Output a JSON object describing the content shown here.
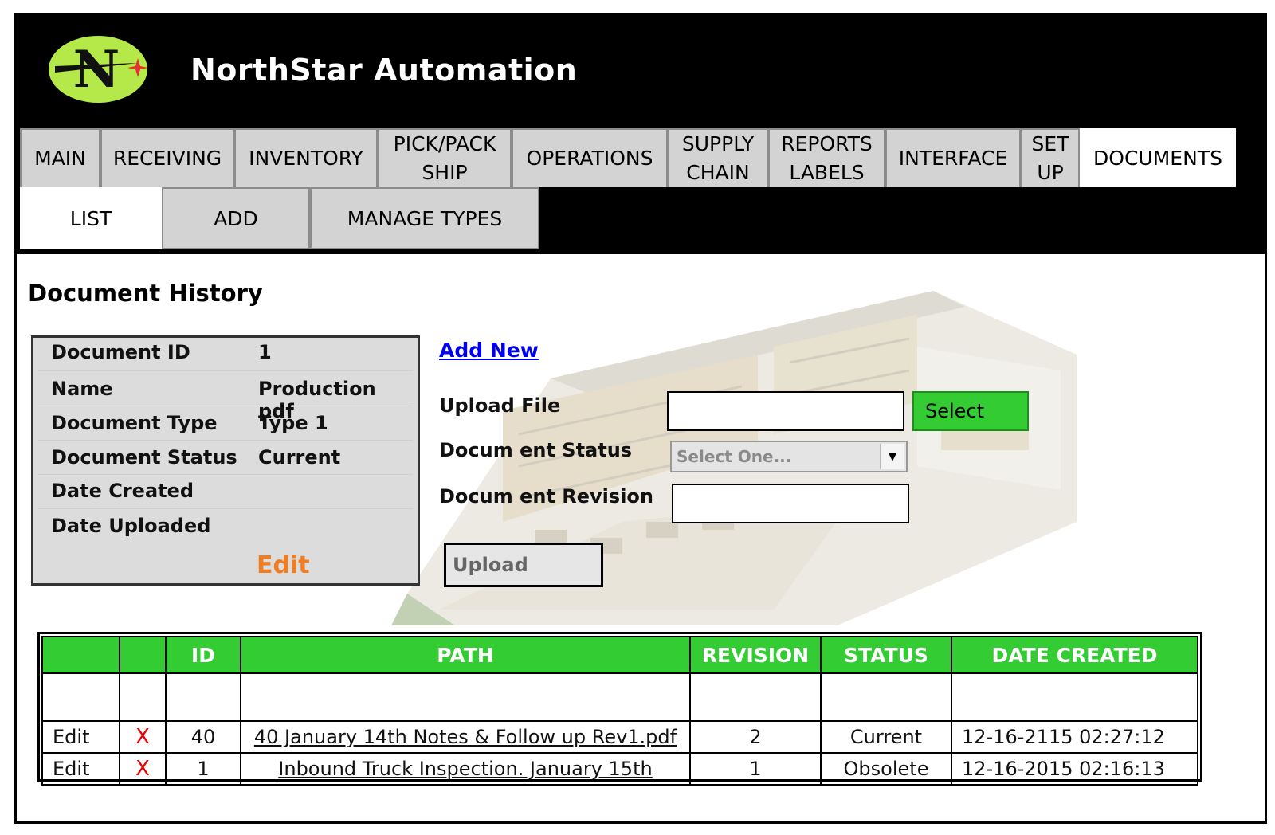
{
  "app": {
    "title": "NorthStar Automation",
    "logo_letter": "N"
  },
  "nav": {
    "tabs": [
      {
        "label": "MAIN"
      },
      {
        "label": "RECEIVING"
      },
      {
        "label": "INVENTORY"
      },
      {
        "label": "PICK/PACK\nSHIP"
      },
      {
        "label": "OPERATIONS"
      },
      {
        "label": "SUPPLY\nCHAIN"
      },
      {
        "label": "REPORTS\nLABELS"
      },
      {
        "label": "INTERFACE"
      },
      {
        "label": "SET\nUP"
      },
      {
        "label": "DOCUMENTS",
        "active": true
      }
    ]
  },
  "subnav": {
    "tabs": [
      {
        "label": "LIST",
        "active": true
      },
      {
        "label": "ADD"
      },
      {
        "label": "MANAGE TYPES"
      }
    ]
  },
  "page": {
    "title": "Document History"
  },
  "details": {
    "rows": [
      {
        "label": "Document ID",
        "value": "1"
      },
      {
        "label": "Name",
        "value": "Production pdf"
      },
      {
        "label": "Document Type",
        "value": "Type 1"
      },
      {
        "label": "Document Status",
        "value": "Current"
      },
      {
        "label": "Date Created",
        "value": ""
      },
      {
        "label": "Date Uploaded",
        "value": ""
      }
    ],
    "edit_label": "Edit"
  },
  "upload_form": {
    "add_new_label": "Add New",
    "upload_file_label": "Upload File",
    "upload_file_value": "",
    "select_label": "Select",
    "status_label": "Docum ent Status",
    "status_selected": "Select One...",
    "revision_label": "Docum ent Revision",
    "revision_value": "",
    "upload_label": "Upload"
  },
  "table": {
    "columns": [
      "",
      "",
      "ID",
      "PATH",
      "REVISION",
      "STATUS",
      "DATE CREATED"
    ],
    "rows": [
      {
        "edit": "Edit",
        "delete": "X",
        "id": "40",
        "path": "40 January 14th Notes & Follow up Rev1.pdf",
        "revision": "2",
        "status": "Current",
        "date_created": "12-16-2115 02:27:12"
      },
      {
        "edit": "Edit",
        "delete": "X",
        "id": "1",
        "path": "Inbound Truck Inspection. January 15th",
        "revision": "1",
        "status": "Obsolete",
        "date_created": "12-16-2015 02:16:13"
      }
    ]
  },
  "colors": {
    "accent_green": "#33cc33",
    "edit_orange": "#f07d21",
    "delete_red": "#ee0000",
    "logo_green": "#b5e94a"
  }
}
